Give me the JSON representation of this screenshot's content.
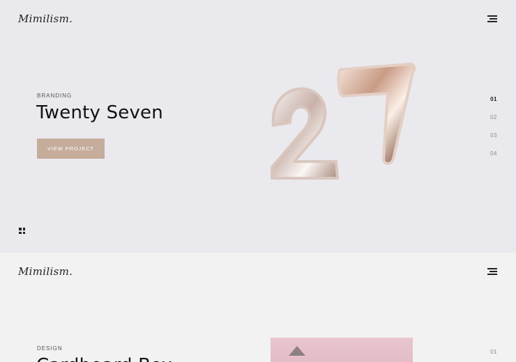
{
  "slides": [
    {
      "logo": "Mimilism.",
      "category": "BRANDING",
      "title": "Twenty Seven",
      "button_label": "VIEW PROJECT",
      "pagination": [
        "01",
        "02",
        "03",
        "04"
      ],
      "active_page": "01",
      "image_icon": "balloons-27-image"
    },
    {
      "logo": "Mimilism.",
      "category": "DESIGN",
      "title": "Cardboard Box",
      "pagination": [
        "01"
      ],
      "active_page": "01",
      "image_icon": "pink-box-image"
    }
  ],
  "colors": {
    "accent": "#c5ac9b",
    "panel1_bg": "#eae9ee",
    "panel2_bg": "#f2f2f2"
  }
}
